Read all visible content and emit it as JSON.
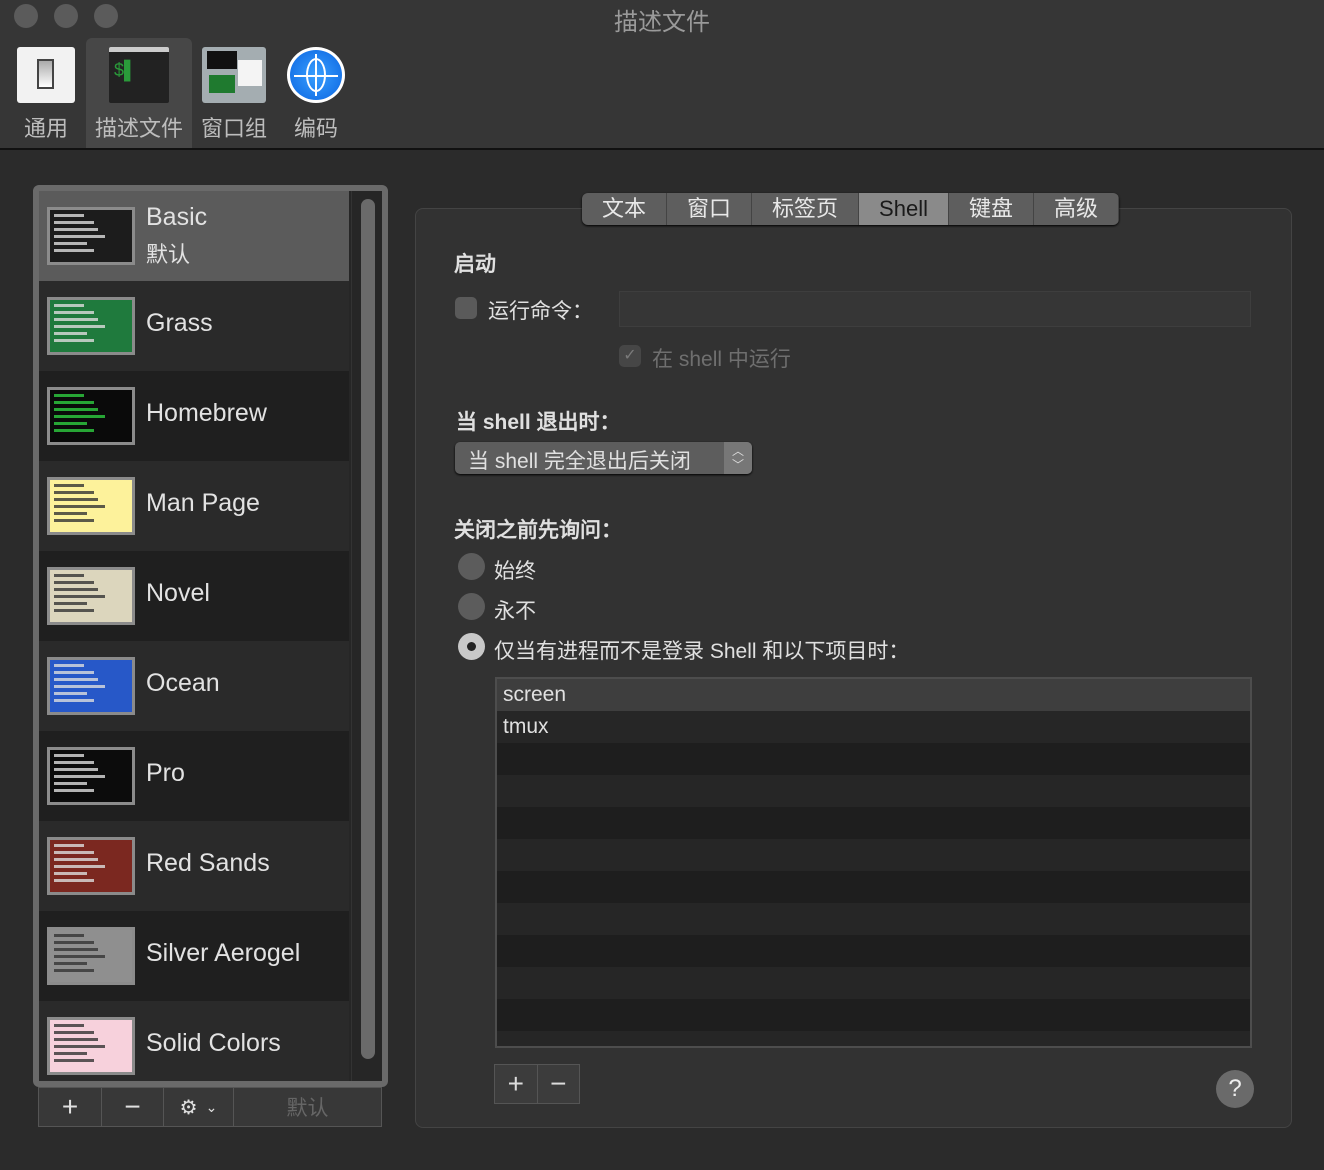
{
  "window": {
    "title": "描述文件"
  },
  "toolbar": {
    "items": [
      {
        "label": "通用",
        "icon": "switch-icon"
      },
      {
        "label": "描述文件",
        "icon": "terminal-icon",
        "selected": true
      },
      {
        "label": "窗口组",
        "icon": "window-groups-icon"
      },
      {
        "label": "编码",
        "icon": "globe-icon"
      }
    ]
  },
  "profiles": {
    "items": [
      {
        "name": "Basic",
        "subtitle": "默认",
        "color": "#1c1c1c",
        "selected": true
      },
      {
        "name": "Grass",
        "color": "#1f7a3d"
      },
      {
        "name": "Homebrew",
        "color": "#0a0a0a"
      },
      {
        "name": "Man Page",
        "color": "#fdf29b"
      },
      {
        "name": "Novel",
        "color": "#dcd6bd"
      },
      {
        "name": "Ocean",
        "color": "#2758c8"
      },
      {
        "name": "Pro",
        "color": "#0c0c0c"
      },
      {
        "name": "Red Sands",
        "color": "#7b2820"
      },
      {
        "name": "Silver Aerogel",
        "color": "#8f8f8f"
      },
      {
        "name": "Solid Colors",
        "color": "#f7d1dc"
      }
    ],
    "add_label": "+",
    "remove_label": "−",
    "default_label": "默认"
  },
  "tabs": [
    "文本",
    "窗口",
    "标签页",
    "Shell",
    "键盘",
    "高级"
  ],
  "active_tab": "Shell",
  "startup": {
    "heading": "启动",
    "run_command_label": "运行命令：",
    "run_command_checked": false,
    "command_value": "",
    "run_in_shell_label": "在 shell 中运行",
    "run_in_shell_checked": true
  },
  "on_exit": {
    "heading": "当 shell 退出时：",
    "selected": "当 shell 完全退出后关闭"
  },
  "ask_before_close": {
    "heading": "关闭之前先询问：",
    "options": [
      "始终",
      "永不",
      "仅当有进程而不是登录 Shell 和以下项目时："
    ],
    "selected_index": 2
  },
  "processes": [
    "screen",
    "tmux"
  ],
  "help_label": "?"
}
